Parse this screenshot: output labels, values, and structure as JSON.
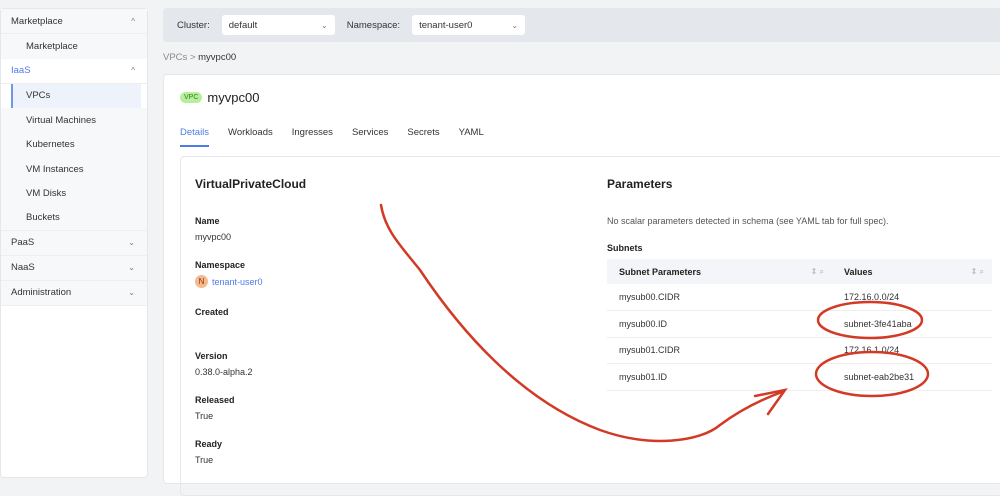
{
  "sidebar": {
    "groups": [
      {
        "label": "Marketplace",
        "items": [
          "Marketplace"
        ]
      },
      {
        "label": "IaaS",
        "items": [
          "VPCs",
          "Virtual Machines",
          "Kubernetes",
          "VM Instances",
          "VM Disks",
          "Buckets"
        ]
      },
      {
        "label": "PaaS"
      },
      {
        "label": "NaaS"
      },
      {
        "label": "Administration"
      }
    ]
  },
  "topbar": {
    "cluster_label": "Cluster:",
    "cluster_value": "default",
    "namespace_label": "Namespace:",
    "namespace_value": "tenant-user0"
  },
  "breadcrumb": {
    "parent": "VPCs",
    "sep": ">",
    "current": "myvpc00"
  },
  "header": {
    "badge": "VPC",
    "title": "myvpc00"
  },
  "tabs": [
    "Details",
    "Workloads",
    "Ingresses",
    "Services",
    "Secrets",
    "YAML"
  ],
  "details": {
    "heading": "VirtualPrivateCloud",
    "fields": [
      {
        "label": "Name",
        "value": "myvpc00"
      },
      {
        "label": "Namespace",
        "value": "tenant-user0",
        "avatar": "N"
      },
      {
        "label": "Created",
        "value": ""
      },
      {
        "label": "Version",
        "value": "0.38.0-alpha.2"
      },
      {
        "label": "Released",
        "value": "True"
      },
      {
        "label": "Ready",
        "value": "True"
      }
    ]
  },
  "parameters": {
    "heading": "Parameters",
    "note": "No scalar parameters detected in schema (see YAML tab for full spec).",
    "subnets_label": "Subnets",
    "columns": [
      "Subnet Parameters",
      "Values"
    ],
    "rows": [
      [
        "mysub00.CIDR",
        "172.16.0.0/24"
      ],
      [
        "mysub00.ID",
        "subnet-3fe41aba"
      ],
      [
        "mysub01.CIDR",
        "172.16.1.0/24"
      ],
      [
        "mysub01.ID",
        "subnet-eab2be31"
      ]
    ]
  },
  "annotation_color": "#d23a25"
}
